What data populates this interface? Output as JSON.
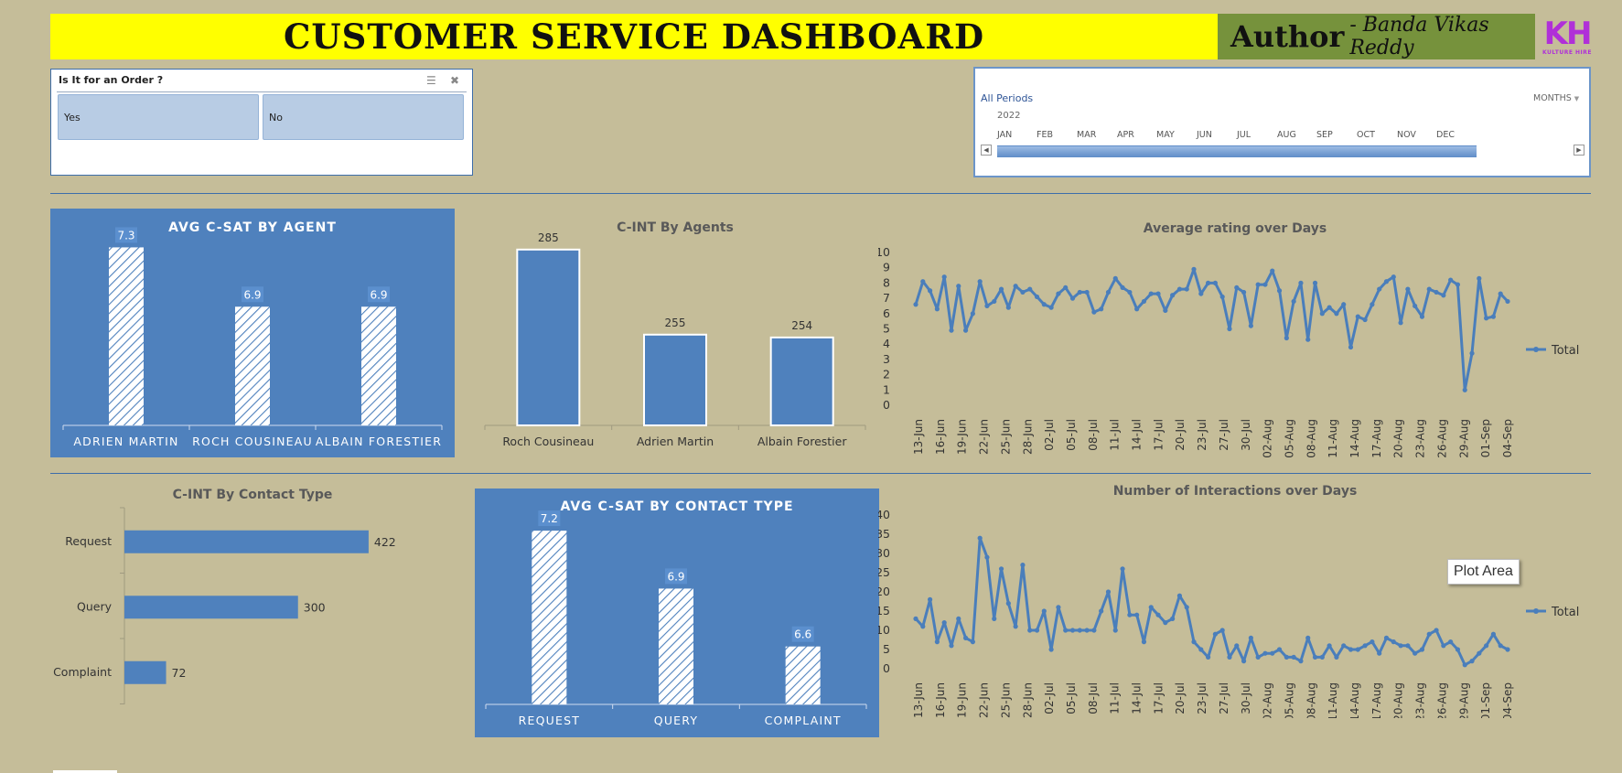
{
  "header": {
    "title": "CUSTOMER SERVICE DASHBOARD",
    "author_label": "Author",
    "author_name": "- Banda Vikas Reddy",
    "logo_mark": "KH",
    "logo_text": "KULTURE HIRE",
    "title_bg": "#FFFF00",
    "author_bg": "#76923C"
  },
  "slicer": {
    "title": "Is It for an Order ?",
    "options": [
      "Yes",
      "No"
    ],
    "icons": [
      "multi-select-icon",
      "clear-filter-icon"
    ]
  },
  "timeline": {
    "label": "All Periods",
    "level": "MONTHS",
    "year": "2022",
    "months": [
      "JAN",
      "FEB",
      "MAR",
      "APR",
      "MAY",
      "JUN",
      "JUL",
      "AUG",
      "SEP",
      "OCT",
      "NOV",
      "DEC"
    ]
  },
  "colors": {
    "accent": "#4F81BD",
    "background": "#C5BD99",
    "line": "#4A7EBB"
  },
  "tooltip": "Plot Area",
  "chart_data": [
    {
      "id": "avg-csat-agent",
      "type": "bar",
      "title": "AVG C-SAT BY AGENT",
      "categories": [
        "ADRIEN MARTIN",
        "ROCH COUSINEAU",
        "ALBAIN FORESTIER"
      ],
      "values": [
        7.3,
        6.9,
        6.9
      ],
      "labels": [
        "7.3",
        "6.9",
        "6.9"
      ],
      "ylim": [
        6.1,
        7.5
      ]
    },
    {
      "id": "cint-agents",
      "type": "bar",
      "title": "C-INT By Agents",
      "categories": [
        "Roch Cousineau",
        "Adrien Martin",
        "Albain Forestier"
      ],
      "values": [
        285,
        255,
        254
      ],
      "labels": [
        "285",
        "255",
        "254"
      ],
      "ylim": [
        223,
        293
      ]
    },
    {
      "id": "avg-rating-days",
      "type": "line",
      "title": "Average rating over Days",
      "series": [
        {
          "name": "Total",
          "values": [
            6.6,
            8.1,
            7.5,
            6.3,
            8.4,
            4.9,
            7.8,
            4.9,
            6.0,
            8.1,
            6.5,
            6.8,
            7.6,
            6.4,
            7.8,
            7.4,
            7.6,
            7.1,
            6.6,
            6.4,
            7.3,
            7.7,
            7.0,
            7.4,
            7.4,
            6.1,
            6.3,
            7.4,
            8.3,
            7.7,
            7.4,
            6.3,
            6.8,
            7.3,
            7.3,
            6.2,
            7.2,
            7.6,
            7.6,
            8.9,
            7.3,
            8.0,
            8.0,
            7.1,
            5.0,
            7.7,
            7.4,
            5.2,
            7.9,
            7.9,
            8.8,
            7.5,
            4.4,
            6.8,
            8.0,
            4.3,
            8.0,
            6.0,
            6.4,
            6.0,
            6.6,
            3.8,
            5.8,
            5.6,
            6.6,
            7.6,
            8.1,
            8.4,
            5.4,
            7.6,
            6.5,
            5.8,
            7.6,
            7.4,
            7.2,
            8.2,
            7.9,
            1.0,
            3.4,
            8.3,
            5.7,
            5.8,
            7.3,
            6.8
          ]
        }
      ],
      "x_ticks": [
        "13-Jun",
        "16-Jun",
        "19-Jun",
        "22-Jun",
        "25-Jun",
        "28-Jun",
        "02-Jul",
        "05-Jul",
        "08-Jul",
        "11-Jul",
        "14-Jul",
        "17-Jul",
        "20-Jul",
        "23-Jul",
        "27-Jul",
        "30-Jul",
        "02-Aug",
        "05-Aug",
        "08-Aug",
        "11-Aug",
        "14-Aug",
        "17-Aug",
        "20-Aug",
        "23-Aug",
        "26-Aug",
        "29-Aug",
        "01-Sep",
        "04-Sep"
      ],
      "y_ticks": [
        0,
        1,
        2,
        3,
        4,
        5,
        6,
        7,
        8,
        9,
        10
      ],
      "ylim": [
        0,
        10
      ],
      "legend": "right"
    },
    {
      "id": "cint-contact-type",
      "type": "bar",
      "orientation": "horizontal",
      "title": "C-INT By Contact Type",
      "categories": [
        "Request",
        "Query",
        "Complaint"
      ],
      "values": [
        422,
        300,
        72
      ],
      "labels": [
        "422",
        "300",
        "72"
      ],
      "xlim": [
        0,
        450
      ]
    },
    {
      "id": "avg-csat-contact",
      "type": "bar",
      "title": "AVG C-SAT BY CONTACT TYPE",
      "categories": [
        "REQUEST",
        "QUERY",
        "COMPLAINT"
      ],
      "values": [
        7.2,
        6.9,
        6.6
      ],
      "labels": [
        "7.2",
        "6.9",
        "6.6"
      ],
      "ylim": [
        6.3,
        7.3
      ]
    },
    {
      "id": "interactions-days",
      "type": "line",
      "title": "Number of Interactions over Days",
      "series": [
        {
          "name": "Total",
          "values": [
            13,
            11,
            18,
            7,
            12,
            6,
            13,
            8,
            7,
            34,
            29,
            13,
            26,
            17,
            11,
            27,
            10,
            10,
            15,
            5,
            16,
            10,
            10,
            10,
            10,
            10,
            15,
            20,
            10,
            26,
            14,
            14,
            7,
            16,
            14,
            12,
            13,
            19,
            16,
            7,
            5,
            3,
            9,
            10,
            3,
            6,
            2,
            8,
            3,
            4,
            4,
            5,
            3,
            3,
            2,
            8,
            3,
            3,
            6,
            3,
            6,
            5,
            5,
            6,
            7,
            4,
            8,
            7,
            6,
            6,
            4,
            5,
            9,
            10,
            6,
            7,
            5,
            1,
            2,
            4,
            6,
            9,
            6,
            5
          ]
        }
      ],
      "x_ticks": [
        "13-Jun",
        "16-Jun",
        "19-Jun",
        "22-Jun",
        "25-Jun",
        "28-Jun",
        "02-Jul",
        "05-Jul",
        "08-Jul",
        "11-Jul",
        "14-Jul",
        "17-Jul",
        "20-Jul",
        "23-Jul",
        "27-Jul",
        "30-Jul",
        "02-Aug",
        "05-Aug",
        "08-Aug",
        "11-Aug",
        "14-Aug",
        "17-Aug",
        "20-Aug",
        "23-Aug",
        "26-Aug",
        "29-Aug",
        "01-Sep",
        "04-Sep"
      ],
      "y_ticks": [
        0,
        5,
        10,
        15,
        20,
        25,
        30,
        35,
        40
      ],
      "ylim": [
        0,
        40
      ],
      "legend": "right"
    }
  ]
}
